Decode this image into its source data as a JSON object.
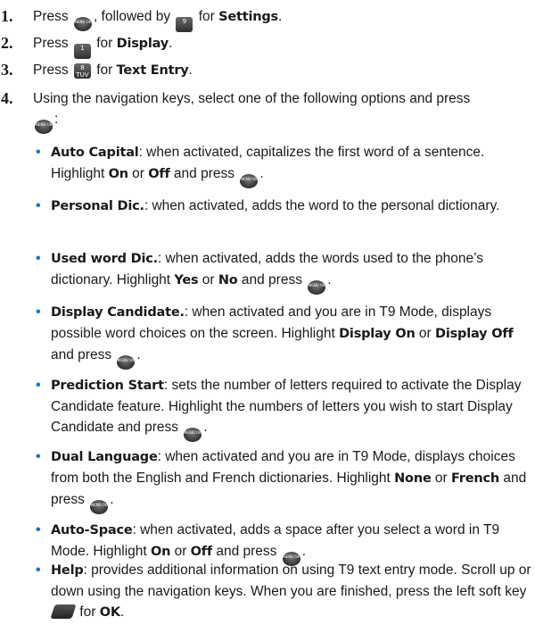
{
  "key_glyphs": {
    "menu_ok": "MENU OK",
    "settings_key": "9",
    "display_key": "1",
    "text_entry_key": "8 TUV"
  },
  "steps": [
    {
      "num": "1.",
      "t1": "Press ",
      "t2": ", followed by ",
      "t3": " for ",
      "bold": "Settings",
      "end": "."
    },
    {
      "num": "2.",
      "t1": "Press ",
      "t2": " for ",
      "bold": "Display",
      "end": "."
    },
    {
      "num": "3.",
      "t1": "Press ",
      "t2": " for ",
      "bold": "Text Entry",
      "end": "."
    },
    {
      "num": "4.",
      "l1": "Using the navigation keys, select one of the following options and press",
      "end": ":"
    }
  ],
  "options": [
    {
      "term": "Auto Capital",
      "desc": ": when activated, capitalizes the first word of a sentence. Highlight ",
      "b1": "On",
      "mid": " or ",
      "b2": "Off",
      "end": " and press "
    },
    {
      "term": "Personal Dic.",
      "desc": ": when activated, adds the word to the personal dictionary."
    },
    {
      "term": "Used word Dic.",
      "desc": ": when activated, adds the words used to the phone’s dictionary. Highlight ",
      "b1": "Yes",
      "mid": " or ",
      "b2": "No",
      "end": " and press "
    },
    {
      "term": "Display Candidate.",
      "desc": ": when activated and you are in T9 Mode, displays possible word choices on the screen. Highlight ",
      "b1": "Display On",
      "mid": " or ",
      "b2": "Display Off",
      "end": " and press "
    },
    {
      "term": "Prediction Start",
      "desc": ": sets the number of letters required to activate the Display Candidate feature. Highlight the numbers of letters you wish to start Display Candidate and press "
    },
    {
      "term": "Dual Language",
      "desc": ": when activated and you are in T9 Mode, displays choices from both the English and French dictionaries. Highlight ",
      "b1": "None",
      "mid": " or ",
      "b2": "French",
      "end": " and press "
    },
    {
      "term": "Auto-Space",
      "desc": ": when activated, adds a space after you select a word in T9 Mode. Highlight ",
      "b1": "On",
      "mid": " or ",
      "b2": "Off",
      "end": " and press "
    },
    {
      "term": "Help",
      "desc": ": provides additional information on using T9 text entry mode. Scroll up or down using the navigation keys. When you are finished, press the left soft key ",
      "mid": " for ",
      "b2": "OK"
    }
  ]
}
